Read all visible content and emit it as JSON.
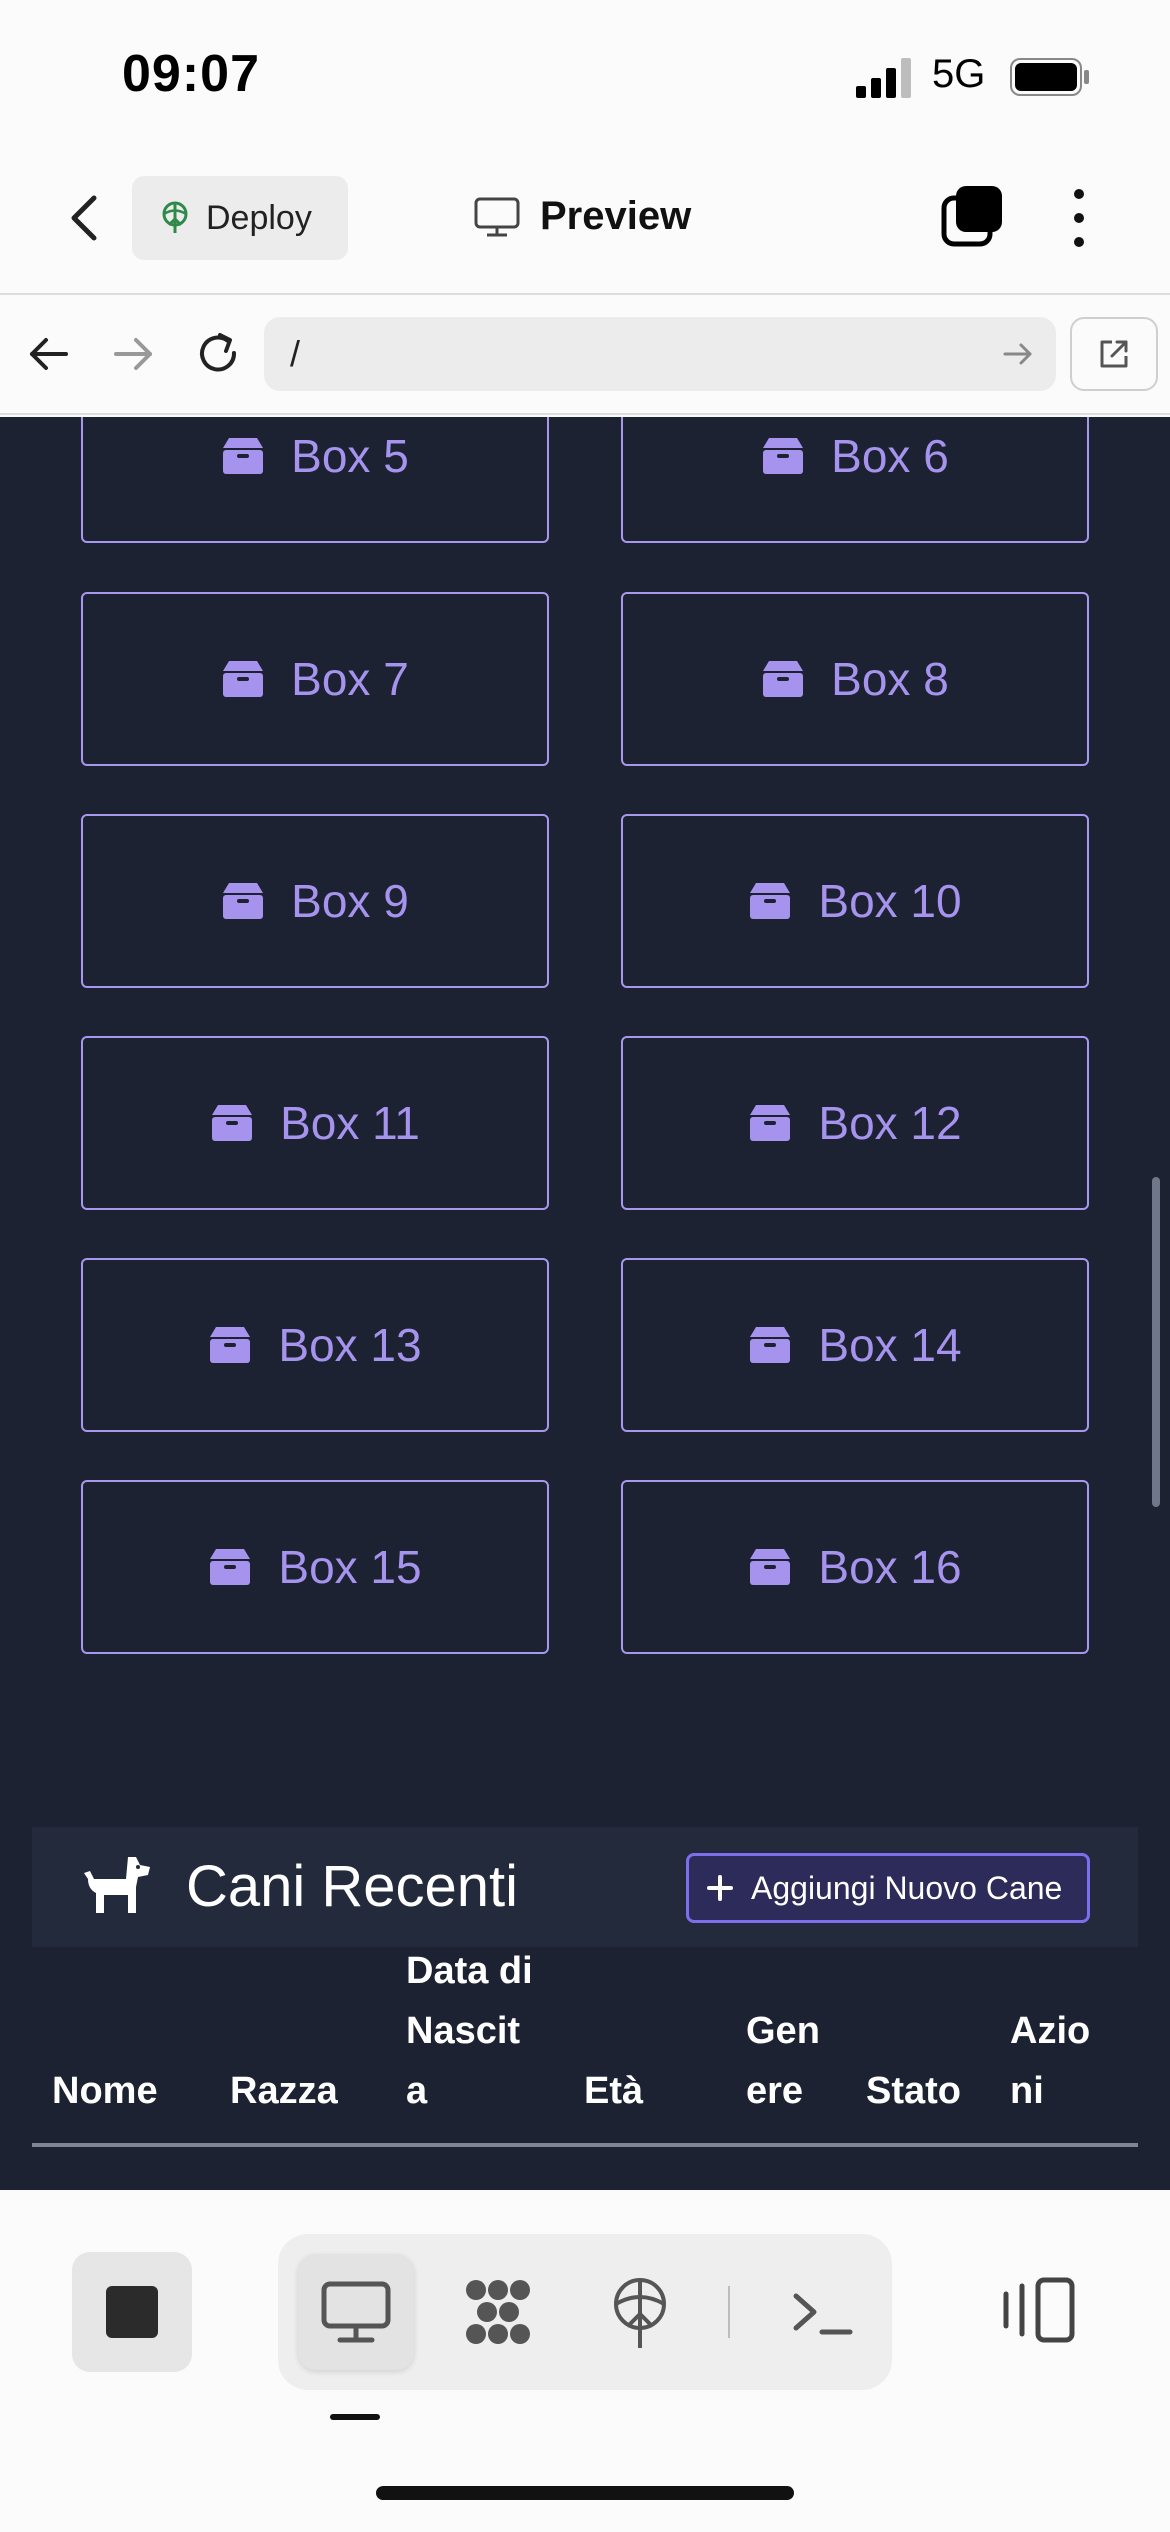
{
  "status_bar": {
    "time": "09:07",
    "network": "5G"
  },
  "toolbar": {
    "deploy_label": "Deploy",
    "preview_label": "Preview"
  },
  "browser": {
    "url": "/"
  },
  "boxes": [
    "Box 5",
    "Box 6",
    "Box 7",
    "Box 8",
    "Box 9",
    "Box 10",
    "Box 11",
    "Box 12",
    "Box 13",
    "Box 14",
    "Box 15",
    "Box 16"
  ],
  "recent_dogs": {
    "title": "Cani Recenti",
    "add_button": "Aggiungi Nuovo Cane",
    "columns": {
      "nome": "Nome",
      "razza": "Razza",
      "nascita": [
        "Data di",
        "Nascit",
        "a"
      ],
      "eta": "Età",
      "genere": [
        "Gen",
        "ere"
      ],
      "stato": "Stato",
      "azioni": [
        "Azio",
        "ni"
      ]
    }
  },
  "colors": {
    "page_bg": "#1d2232",
    "accent": "#a593ee",
    "button_border": "#7d6ef0"
  }
}
